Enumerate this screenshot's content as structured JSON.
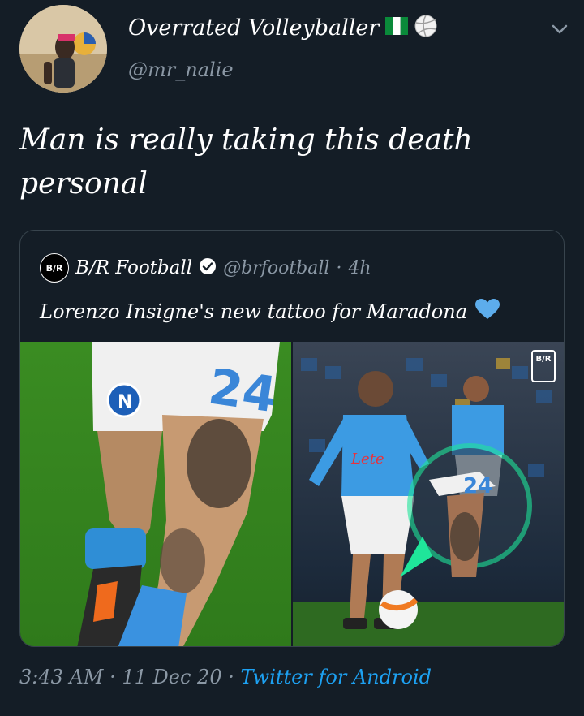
{
  "tweet": {
    "display_name": "Overrated Volleyballer",
    "flag_icon": "nigeria-flag-icon",
    "ball_icon": "volleyball-icon",
    "handle": "@mr_nalie",
    "text": "Man is really taking this death personal",
    "timestamp": "3:43 AM",
    "date": "11 Dec 20",
    "separator": "·",
    "source": "Twitter for Android"
  },
  "quoted": {
    "logo_text": "B/R",
    "name": "B/R Football",
    "handle": "@brfootball",
    "age": "4h",
    "text": "Lorenzo Insigne's new tattoo for Maradona",
    "emoji_icon": "blue-heart-icon",
    "media_watermark": "B/R"
  },
  "colors": {
    "background": "#141d26",
    "muted": "#8b98a5",
    "link": "#1da1f2",
    "border": "#38444d",
    "highlight_circle": "#1fe59a"
  }
}
